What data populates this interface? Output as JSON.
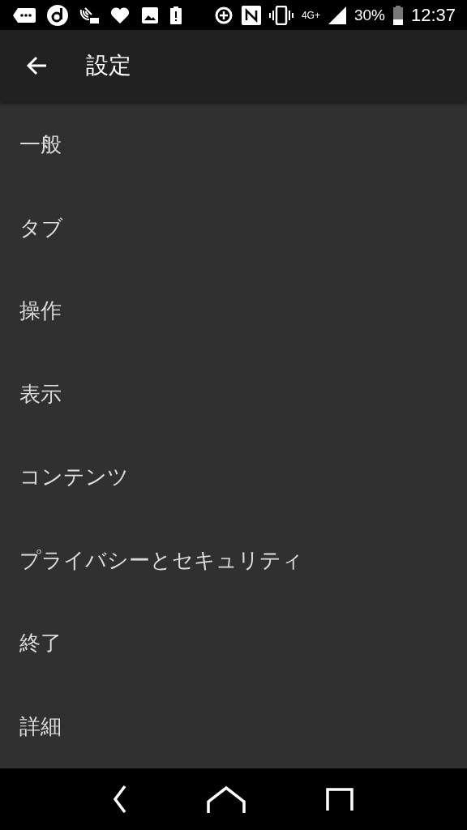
{
  "status_bar": {
    "network": "4G+",
    "battery": "30%",
    "time": "12:37"
  },
  "app_bar": {
    "title": "設定"
  },
  "settings": [
    {
      "label": "一般"
    },
    {
      "label": "タブ"
    },
    {
      "label": "操作"
    },
    {
      "label": "表示"
    },
    {
      "label": "コンテンツ"
    },
    {
      "label": "プライバシーとセキュリティ"
    },
    {
      "label": "終了"
    },
    {
      "label": "詳細"
    }
  ]
}
